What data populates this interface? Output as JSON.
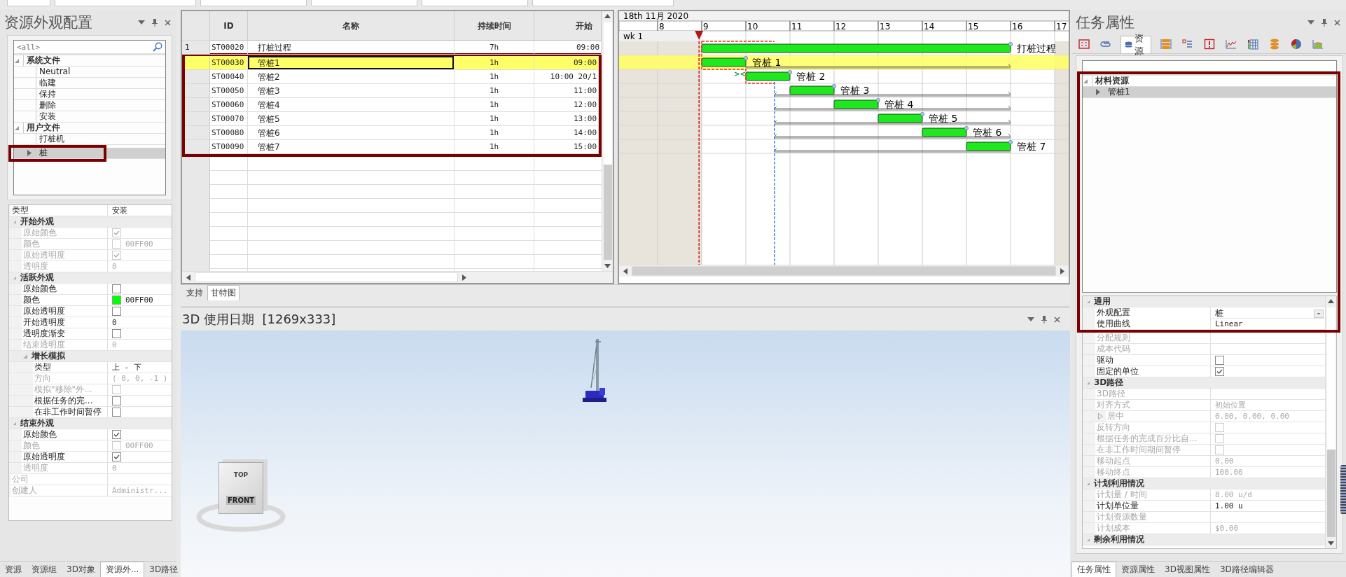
{
  "left_panel": {
    "title": "资源外观配置",
    "search": {
      "placeholder": "<all>"
    },
    "tree": [
      {
        "label": "系统文件",
        "expanded": true,
        "selected": false,
        "children": [
          {
            "label": "Neutral",
            "selected": false
          },
          {
            "label": "临建",
            "selected": false
          },
          {
            "label": "保持",
            "selected": false
          },
          {
            "label": "删除",
            "selected": false
          },
          {
            "label": "安装",
            "selected": false
          }
        ]
      },
      {
        "label": "用户文件",
        "expanded": true,
        "selected": false,
        "children": [
          {
            "label": "打桩机",
            "selected": false
          },
          {
            "label": "桩",
            "selected": true,
            "expanded": false
          }
        ]
      }
    ],
    "properties": [
      {
        "kind": "text",
        "label": "类型",
        "value": "安装",
        "disabled": false
      },
      {
        "kind": "category",
        "label": "开始外观",
        "expanded": true,
        "children": [
          {
            "kind": "check",
            "label": "原始颜色",
            "checked": true,
            "disabled": true
          },
          {
            "kind": "color",
            "label": "颜色",
            "value": "00FF00",
            "disabled": true
          },
          {
            "kind": "check",
            "label": "原始透明度",
            "checked": true,
            "disabled": true
          },
          {
            "kind": "text",
            "label": "透明度",
            "value": "0",
            "disabled": true
          }
        ]
      },
      {
        "kind": "category",
        "label": "活跃外观",
        "expanded": true,
        "children": [
          {
            "kind": "check",
            "label": "原始颜色",
            "checked": false,
            "disabled": false
          },
          {
            "kind": "color",
            "label": "颜色",
            "value": "00FF00",
            "disabled": false
          },
          {
            "kind": "check",
            "label": "原始透明度",
            "checked": false,
            "disabled": false
          },
          {
            "kind": "text",
            "label": "开始透明度",
            "value": "0",
            "disabled": false
          },
          {
            "kind": "check",
            "label": "透明度渐变",
            "checked": false,
            "disabled": false
          },
          {
            "kind": "text",
            "label": "结束透明度",
            "value": "0",
            "disabled": true
          },
          {
            "kind": "category",
            "label": "增长模拟",
            "expanded": true,
            "children": [
              {
                "kind": "text",
                "label": "类型",
                "value": "上 - 下",
                "disabled": false
              },
              {
                "kind": "text",
                "label": "方向",
                "value": "( 0, 0, -1 )",
                "disabled": true
              },
              {
                "kind": "check",
                "label": "模拟\"移除\"外...",
                "checked": false,
                "disabled": true
              },
              {
                "kind": "check",
                "label": "根据任务的完...",
                "checked": false,
                "disabled": false
              },
              {
                "kind": "check",
                "label": "在非工作时间暂停",
                "checked": false,
                "disabled": false
              }
            ]
          }
        ]
      },
      {
        "kind": "category",
        "label": "结束外观",
        "expanded": true,
        "children": [
          {
            "kind": "check",
            "label": "原始颜色",
            "checked": true,
            "disabled": false
          },
          {
            "kind": "color",
            "label": "颜色",
            "value": "00FF00",
            "disabled": true
          },
          {
            "kind": "check",
            "label": "原始透明度",
            "checked": true,
            "disabled": false
          },
          {
            "kind": "text",
            "label": "透明度",
            "value": "0",
            "disabled": true
          }
        ]
      },
      {
        "kind": "text",
        "label": "公司",
        "disabled": true
      },
      {
        "kind": "text",
        "label": "创建人",
        "value": "Administr...",
        "disabled": true
      }
    ],
    "tabs": [
      {
        "label": "资源",
        "selected": false
      },
      {
        "label": "资源组",
        "selected": false
      },
      {
        "label": "3D对象",
        "selected": false
      },
      {
        "label": "资源外...",
        "selected": true
      },
      {
        "label": "3D路径",
        "selected": false
      }
    ]
  },
  "task_table": {
    "columns": [
      "ID",
      "名称",
      "持续时间",
      "开始"
    ],
    "rows": [
      {
        "row_number": "1",
        "id": "ST00020",
        "name": "打桩过程",
        "duration": "7h",
        "start": "09:00",
        "selected": false
      },
      {
        "id": "ST00030",
        "name": "管桩1",
        "duration": "1h",
        "start": "09:00",
        "selected": true
      },
      {
        "id": "ST00040",
        "name": "管桩2",
        "duration": "1h",
        "start": "10:00 20/1",
        "selected": false
      },
      {
        "id": "ST00050",
        "name": "管桩3",
        "duration": "1h",
        "start": "11:00",
        "selected": false
      },
      {
        "id": "ST00060",
        "name": "管桩4",
        "duration": "1h",
        "start": "12:00",
        "selected": false
      },
      {
        "id": "ST00070",
        "name": "管桩5",
        "duration": "1h",
        "start": "13:00",
        "selected": false
      },
      {
        "id": "ST00080",
        "name": "管桩6",
        "duration": "1h",
        "start": "14:00",
        "selected": false
      },
      {
        "id": "ST00090",
        "name": "管桩7",
        "duration": "1h",
        "start": "15:00",
        "selected": false
      }
    ]
  },
  "gantt": {
    "date": "18th 11月 2020",
    "link_marker": "><",
    "hours": [
      "8",
      "9",
      "10",
      "11",
      "12",
      "13",
      "14",
      "15",
      "16",
      "17"
    ],
    "week": "wk 1",
    "bars": [
      {
        "label": "打桩过程"
      },
      {
        "label": "管桩 1"
      },
      {
        "label": "管桩 2"
      },
      {
        "label": "管桩 3"
      },
      {
        "label": "管桩 4"
      },
      {
        "label": "管桩 5"
      },
      {
        "label": "管桩 6"
      },
      {
        "label": "管桩 7"
      }
    ]
  },
  "view_tabs": [
    {
      "label": "支持",
      "selected": false
    },
    {
      "label": "甘特图",
      "selected": true
    }
  ],
  "view_3d": {
    "title": "3D 使用日期  [1269x333]",
    "cube_labels": [
      "TOP",
      "FRONT"
    ]
  },
  "right_panel": {
    "title": "任务属性",
    "toolbar_tabs": [
      {
        "selected": false
      },
      {
        "selected": false
      },
      {
        "label": "资源",
        "selected": true
      },
      {
        "selected": false
      },
      {
        "selected": false
      },
      {
        "selected": false
      },
      {
        "selected": false
      },
      {
        "selected": false
      },
      {
        "selected": false
      },
      {
        "selected": false
      },
      {
        "selected": false
      }
    ],
    "tree": [
      {
        "label": "材料资源",
        "expanded": true,
        "selected": false,
        "children": [
          {
            "label": "管桩1",
            "selected": true,
            "expanded": false
          }
        ]
      }
    ],
    "properties": [
      {
        "kind": "category",
        "label": "通用",
        "expanded": true,
        "children": [
          {
            "kind": "dropdown",
            "label": "外观配置",
            "value": "桩",
            "disabled": false
          },
          {
            "kind": "text",
            "label": "使用曲线",
            "value": "Linear",
            "disabled": false
          },
          {
            "kind": "text",
            "label": "分配规则",
            "disabled": true
          },
          {
            "kind": "text",
            "label": "成本代码",
            "disabled": true
          },
          {
            "kind": "check",
            "label": "驱动",
            "checked": false,
            "disabled": false
          },
          {
            "kind": "check",
            "label": "固定的单位",
            "checked": true,
            "disabled": false
          }
        ]
      },
      {
        "kind": "category",
        "label": "3D路径",
        "expanded": true,
        "children": [
          {
            "kind": "text",
            "label": "3D路径",
            "disabled": true
          },
          {
            "kind": "text",
            "label": "对齐方式",
            "value": "初始位置",
            "disabled": true
          },
          {
            "kind": "text",
            "label": "居中",
            "value": "0.00, 0.00, 0.00",
            "disabled": true,
            "expanded": false
          },
          {
            "kind": "check",
            "label": "反转方向",
            "checked": false,
            "disabled": true
          },
          {
            "kind": "check",
            "label": "根据任务的完成百分比自...",
            "checked": false,
            "disabled": true
          },
          {
            "kind": "check",
            "label": "在非工作时间期间暂停",
            "checked": false,
            "disabled": true
          },
          {
            "kind": "text",
            "label": "移动起点",
            "value": "0.00",
            "disabled": true
          },
          {
            "kind": "text",
            "label": "移动终点",
            "value": "100.00",
            "disabled": true
          }
        ]
      },
      {
        "kind": "category",
        "label": "计划利用情况",
        "expanded": true,
        "children": [
          {
            "kind": "text",
            "label": "计划量 / 时间",
            "value": "8.00 u/d",
            "disabled": true
          },
          {
            "kind": "text",
            "label": "计划单位量",
            "value": "1.00 u",
            "disabled": false
          },
          {
            "kind": "text",
            "label": "计划资源数量",
            "disabled": true
          },
          {
            "kind": "text",
            "label": "计划成本",
            "value": "$0.00",
            "disabled": true
          }
        ]
      },
      {
        "kind": "category",
        "label": "剩余利用情况",
        "expanded": true
      }
    ],
    "tabs": [
      {
        "label": "任务属性",
        "selected": true
      },
      {
        "label": "资源属性",
        "selected": false
      },
      {
        "label": "3D视图属性",
        "selected": false
      },
      {
        "label": "3D路径编辑器",
        "selected": false
      }
    ]
  }
}
